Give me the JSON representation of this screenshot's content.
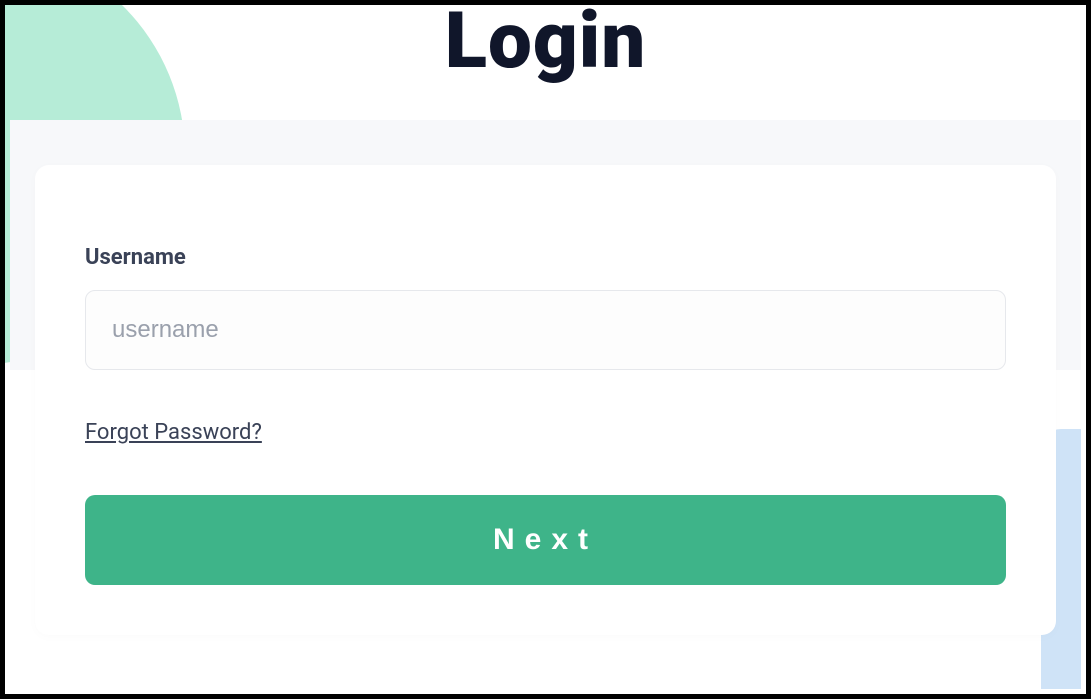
{
  "title": "Login",
  "form": {
    "username_label": "Username",
    "username_placeholder": "username",
    "username_value": "",
    "forgot_link_label": "Forgot Password?",
    "next_button_label": "Next"
  },
  "colors": {
    "accent_green": "#3eb489",
    "decorative_mint": "#b6ecd7",
    "title_navy": "#10162a",
    "text_gray": "#3a4257"
  }
}
